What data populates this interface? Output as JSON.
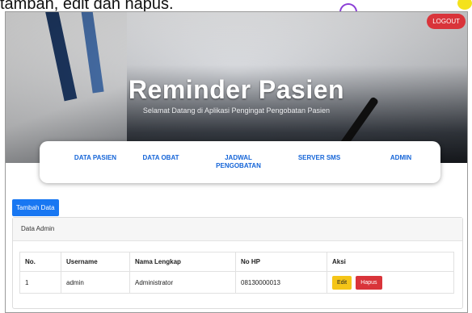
{
  "caption": "tambah, edit dan hapus.",
  "header": {
    "logout_label": "LOGOUT",
    "title": "Reminder Pasien",
    "subtitle": "Selamat Datang di Aplikasi Pengingat Pengobatan Pasien"
  },
  "nav": {
    "items": [
      {
        "label": "DATA PASIEN"
      },
      {
        "label": "DATA OBAT"
      },
      {
        "label": "JADWAL PENGOBATAN"
      },
      {
        "label": "SERVER SMS"
      },
      {
        "label": "ADMIN"
      }
    ]
  },
  "toolbar": {
    "add_label": "Tambah Data"
  },
  "panel": {
    "title": "Data Admin",
    "columns": [
      "No.",
      "Username",
      "Nama Lengkap",
      "No HP",
      "Aksi"
    ],
    "rows": [
      {
        "no": "1",
        "username": "admin",
        "nama": "Administrator",
        "hp": "08130000013"
      }
    ],
    "edit_label": "Edit",
    "delete_label": "Hapus"
  },
  "colors": {
    "accent": "#1565d8",
    "primary_button": "#1877f2",
    "danger": "#d9343a",
    "warning": "#f5c518"
  }
}
